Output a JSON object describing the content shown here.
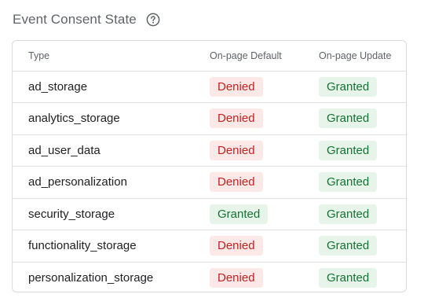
{
  "section": {
    "title": "Event Consent State",
    "help_icon": "help-circle-icon"
  },
  "table": {
    "headers": [
      "Type",
      "On-page Default",
      "On-page Update"
    ],
    "rows": [
      {
        "type": "ad_storage",
        "default": "Denied",
        "update": "Granted"
      },
      {
        "type": "analytics_storage",
        "default": "Denied",
        "update": "Granted"
      },
      {
        "type": "ad_user_data",
        "default": "Denied",
        "update": "Granted"
      },
      {
        "type": "ad_personalization",
        "default": "Denied",
        "update": "Granted"
      },
      {
        "type": "security_storage",
        "default": "Granted",
        "update": "Granted"
      },
      {
        "type": "functionality_storage",
        "default": "Denied",
        "update": "Granted"
      },
      {
        "type": "personalization_storage",
        "default": "Denied",
        "update": "Granted"
      }
    ]
  },
  "colors": {
    "denied_bg": "#fce8e6",
    "denied_text": "#c5221f",
    "granted_bg": "#e6f4ea",
    "granted_text": "#137333"
  }
}
